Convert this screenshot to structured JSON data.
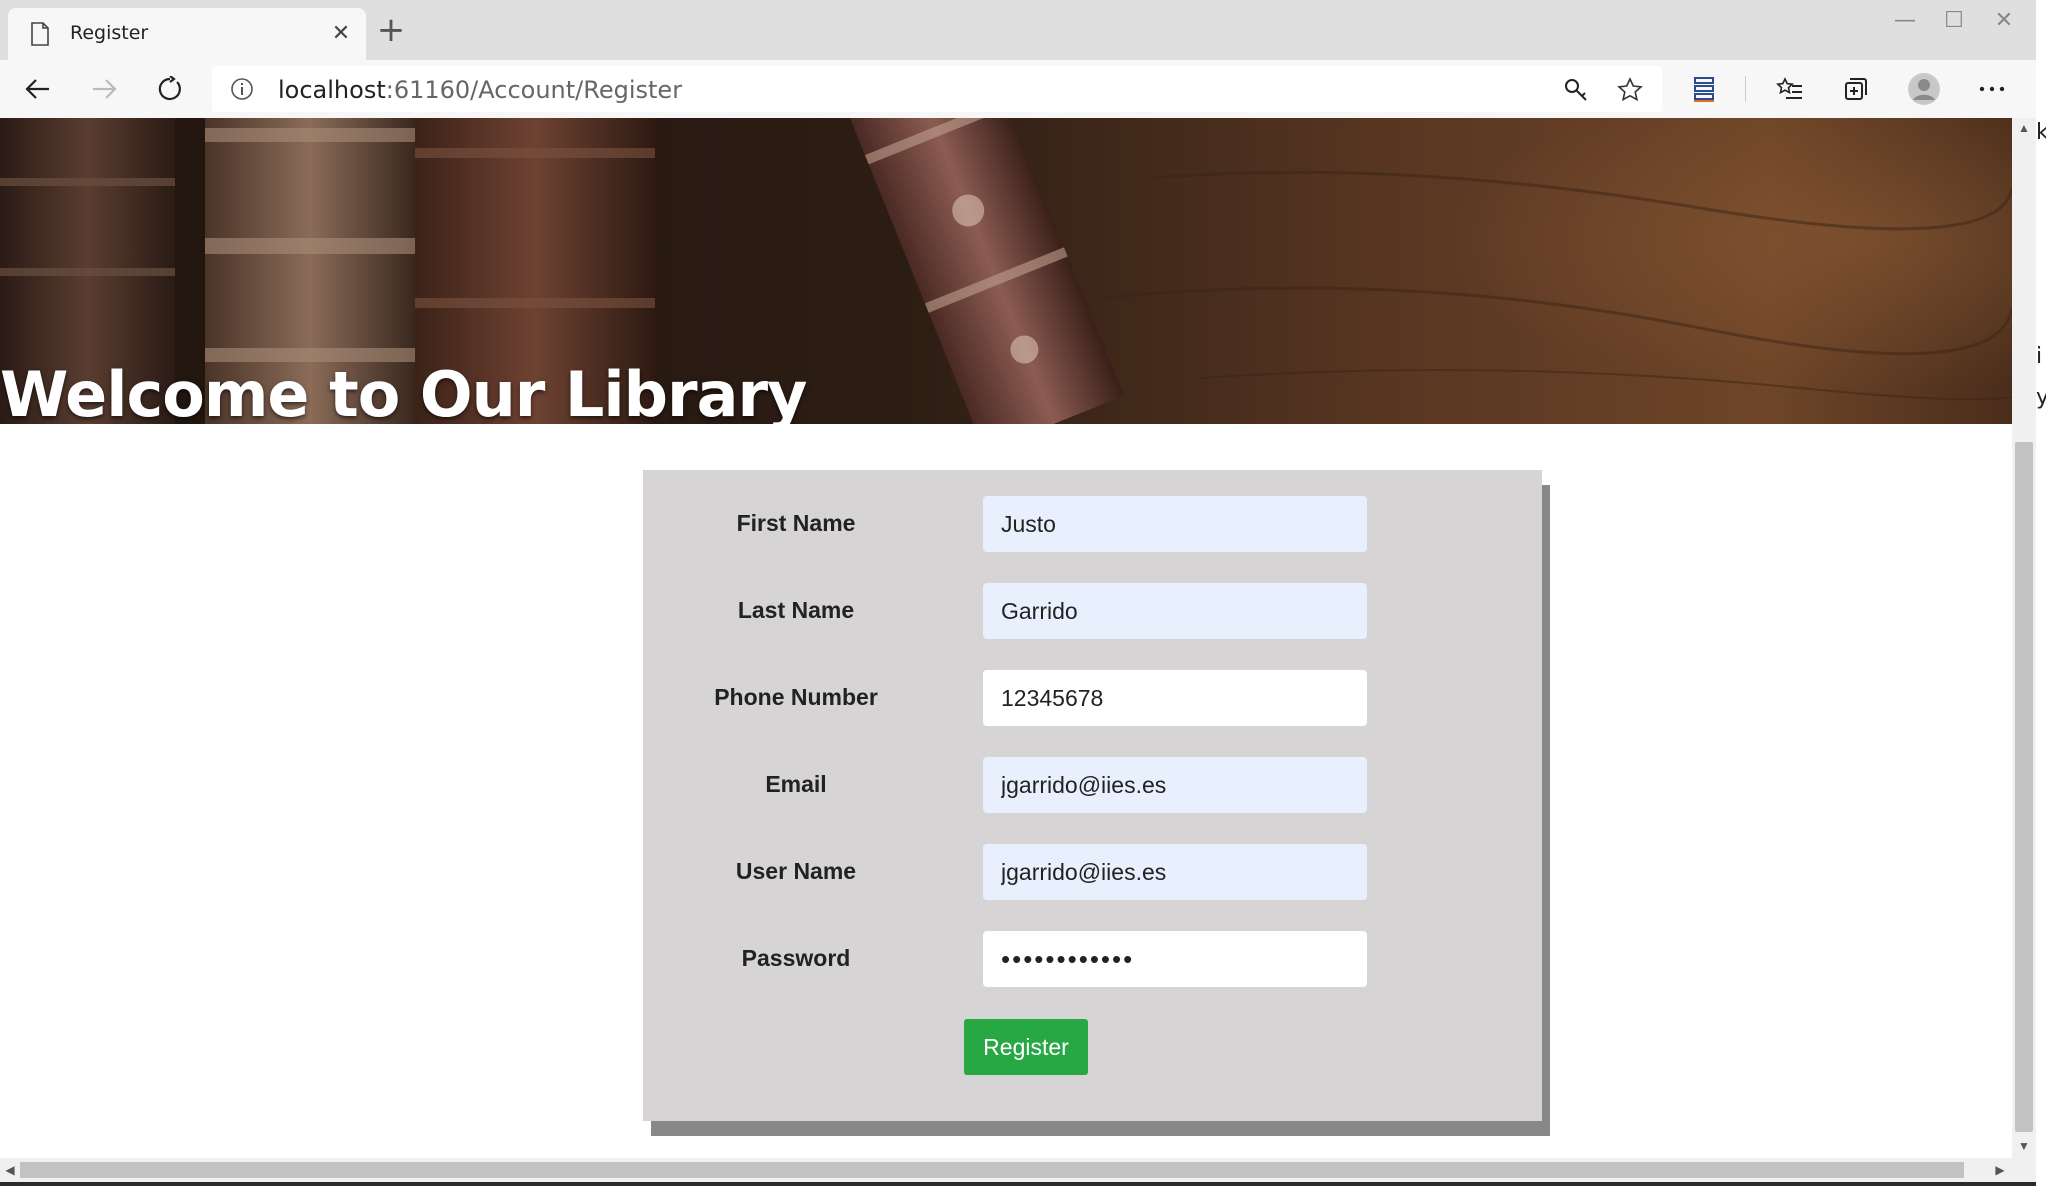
{
  "browser": {
    "tab_title": "Register",
    "url_host": "localhost",
    "url_rest": ":61160/Account/Register",
    "window_controls": {
      "minimize": "—",
      "maximize": "☐",
      "close": "✕"
    },
    "icons": [
      "back-icon",
      "forward-icon",
      "refresh-icon",
      "info-icon",
      "key-icon",
      "star-icon",
      "collections-icon",
      "favorites-icon",
      "share-icon",
      "profile-icon",
      "more-icon"
    ]
  },
  "banner": {
    "title": "Welcome to Our Library"
  },
  "form": {
    "fields": [
      {
        "label": "First Name",
        "value": "Justo",
        "autofill": true
      },
      {
        "label": "Last Name",
        "value": "Garrido",
        "autofill": true
      },
      {
        "label": "Phone Number",
        "value": "12345678",
        "autofill": false
      },
      {
        "label": "Email",
        "value": "jgarrido@iies.es",
        "autofill": true
      },
      {
        "label": "User Name",
        "value": "jgarrido@iies.es",
        "autofill": true
      },
      {
        "label": "Password",
        "value": "••••••••••••",
        "autofill": false
      }
    ],
    "submit_label": "Register",
    "submit_color": "#28a745",
    "panel_color": "#d6d4d5",
    "autofill_color": "#e8f0fe"
  },
  "edge_glyphs": [
    "k",
    "i",
    "y"
  ]
}
